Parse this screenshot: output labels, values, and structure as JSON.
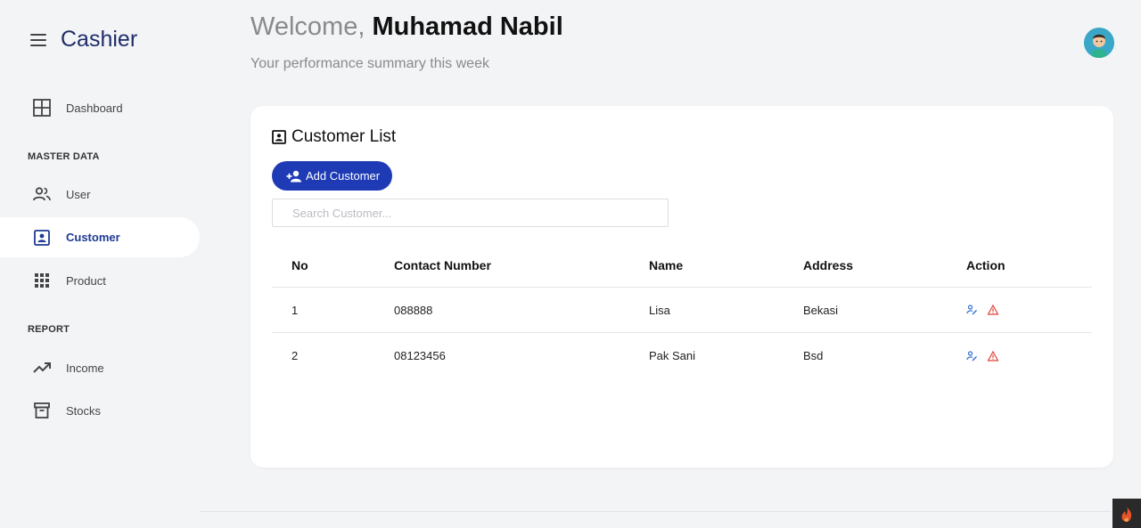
{
  "app": {
    "title": "Cashier"
  },
  "sidebar": {
    "dashboard": "Dashboard",
    "master_data_label": "MASTER DATA",
    "user": "User",
    "customer": "Customer",
    "product": "Product",
    "report_label": "REPORT",
    "income": "Income",
    "stocks": "Stocks"
  },
  "header": {
    "welcome_prefix": "Welcome, ",
    "user_name": "Muhamad Nabil",
    "subtitle": "Your performance summary this week"
  },
  "card": {
    "title": "Customer List",
    "add_button": "Add Customer",
    "search_placeholder": "Search Customer..."
  },
  "table": {
    "headers": [
      "No",
      "Contact Number",
      "Name",
      "Address",
      "Action"
    ],
    "rows": [
      {
        "no": "1",
        "contact": "088888",
        "name": "Lisa",
        "address": "Bekasi"
      },
      {
        "no": "2",
        "contact": "08123456",
        "name": "Pak Sani",
        "address": "Bsd"
      }
    ]
  },
  "colors": {
    "accent": "#1e3bb5",
    "brand_text": "#1f2d6b",
    "edit_icon": "#2f6fd6",
    "delete_icon": "#e0443a"
  },
  "icons": {
    "menu": "hamburger-icon",
    "dashboard": "grid-layout-icon",
    "user": "users-icon",
    "customer": "contact-card-icon",
    "product": "apps-grid-icon",
    "income": "trending-up-icon",
    "stocks": "archive-box-icon",
    "edit": "user-edit-icon",
    "delete": "warning-triangle-icon"
  }
}
